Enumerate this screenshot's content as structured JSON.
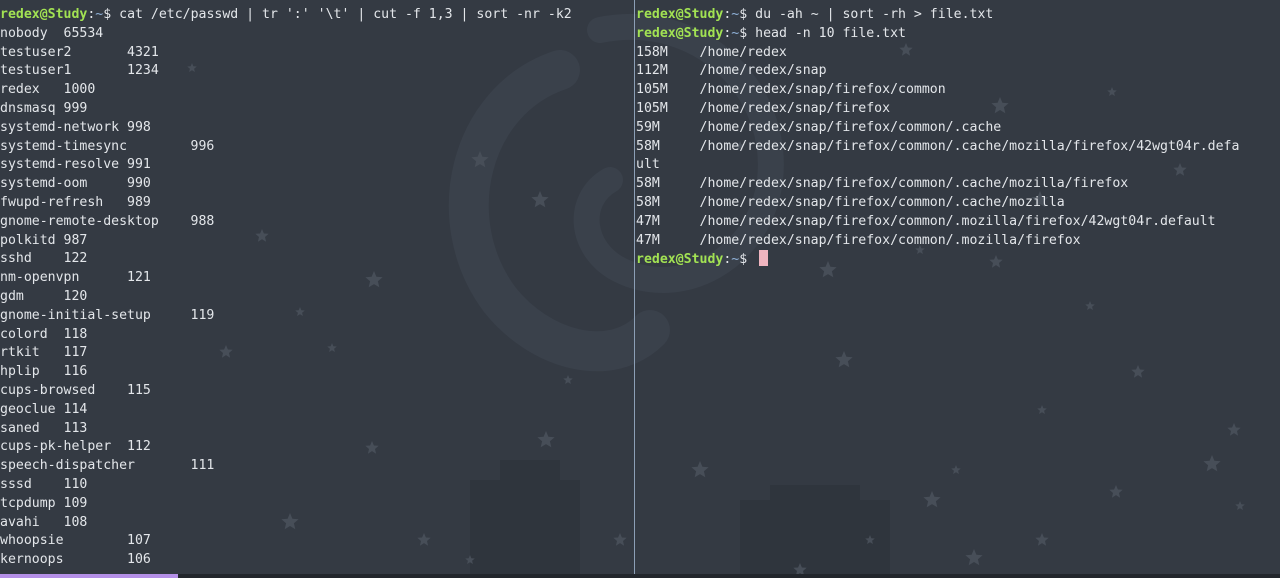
{
  "left_terminal": {
    "prompt": {
      "user_host": "redex@Study",
      "sep": ":",
      "cwd": "~",
      "symbol": "$ "
    },
    "command": "cat /etc/passwd | tr ':' '\\t' | cut -f 1,3 | sort -nr -k2",
    "output": [
      "nobody  65534",
      "testuser2       4321",
      "testuser1       1234",
      "redex   1000",
      "dnsmasq 999",
      "systemd-network 998",
      "systemd-timesync        996",
      "systemd-resolve 991",
      "systemd-oom     990",
      "fwupd-refresh   989",
      "gnome-remote-desktop    988",
      "polkitd 987",
      "sshd    122",
      "nm-openvpn      121",
      "gdm     120",
      "gnome-initial-setup     119",
      "colord  118",
      "rtkit   117",
      "hplip   116",
      "cups-browsed    115",
      "geoclue 114",
      "saned   113",
      "cups-pk-helper  112",
      "speech-dispatcher       111",
      "sssd    110",
      "tcpdump 109",
      "avahi   108",
      "whoopsie        107",
      "kernoops        106"
    ]
  },
  "right_terminal": {
    "prompt": {
      "user_host": "redex@Study",
      "sep": ":",
      "cwd": "~",
      "symbol": "$ "
    },
    "command1": "du -ah ~ | sort -rh > file.txt",
    "command2": "head -n 10 file.txt",
    "output": [
      "158M    /home/redex",
      "112M    /home/redex/snap",
      "105M    /home/redex/snap/firefox/common",
      "105M    /home/redex/snap/firefox",
      "59M     /home/redex/snap/firefox/common/.cache",
      "58M     /home/redex/snap/firefox/common/.cache/mozilla/firefox/42wgt04r.defa",
      "ult",
      "58M     /home/redex/snap/firefox/common/.cache/mozilla/firefox",
      "58M     /home/redex/snap/firefox/common/.cache/mozilla",
      "47M     /home/redex/snap/firefox/common/.mozilla/firefox/42wgt04r.default",
      "47M     /home/redex/snap/firefox/common/.mozilla/firefox"
    ]
  },
  "theme": {
    "background": "#343a43",
    "prompt_user_color": "#a2e253",
    "cwd_color": "#8fb1d8",
    "cursor_color": "#f0b5c0",
    "divider_color": "#8c9fb6",
    "accent_color": "#b590e8"
  }
}
